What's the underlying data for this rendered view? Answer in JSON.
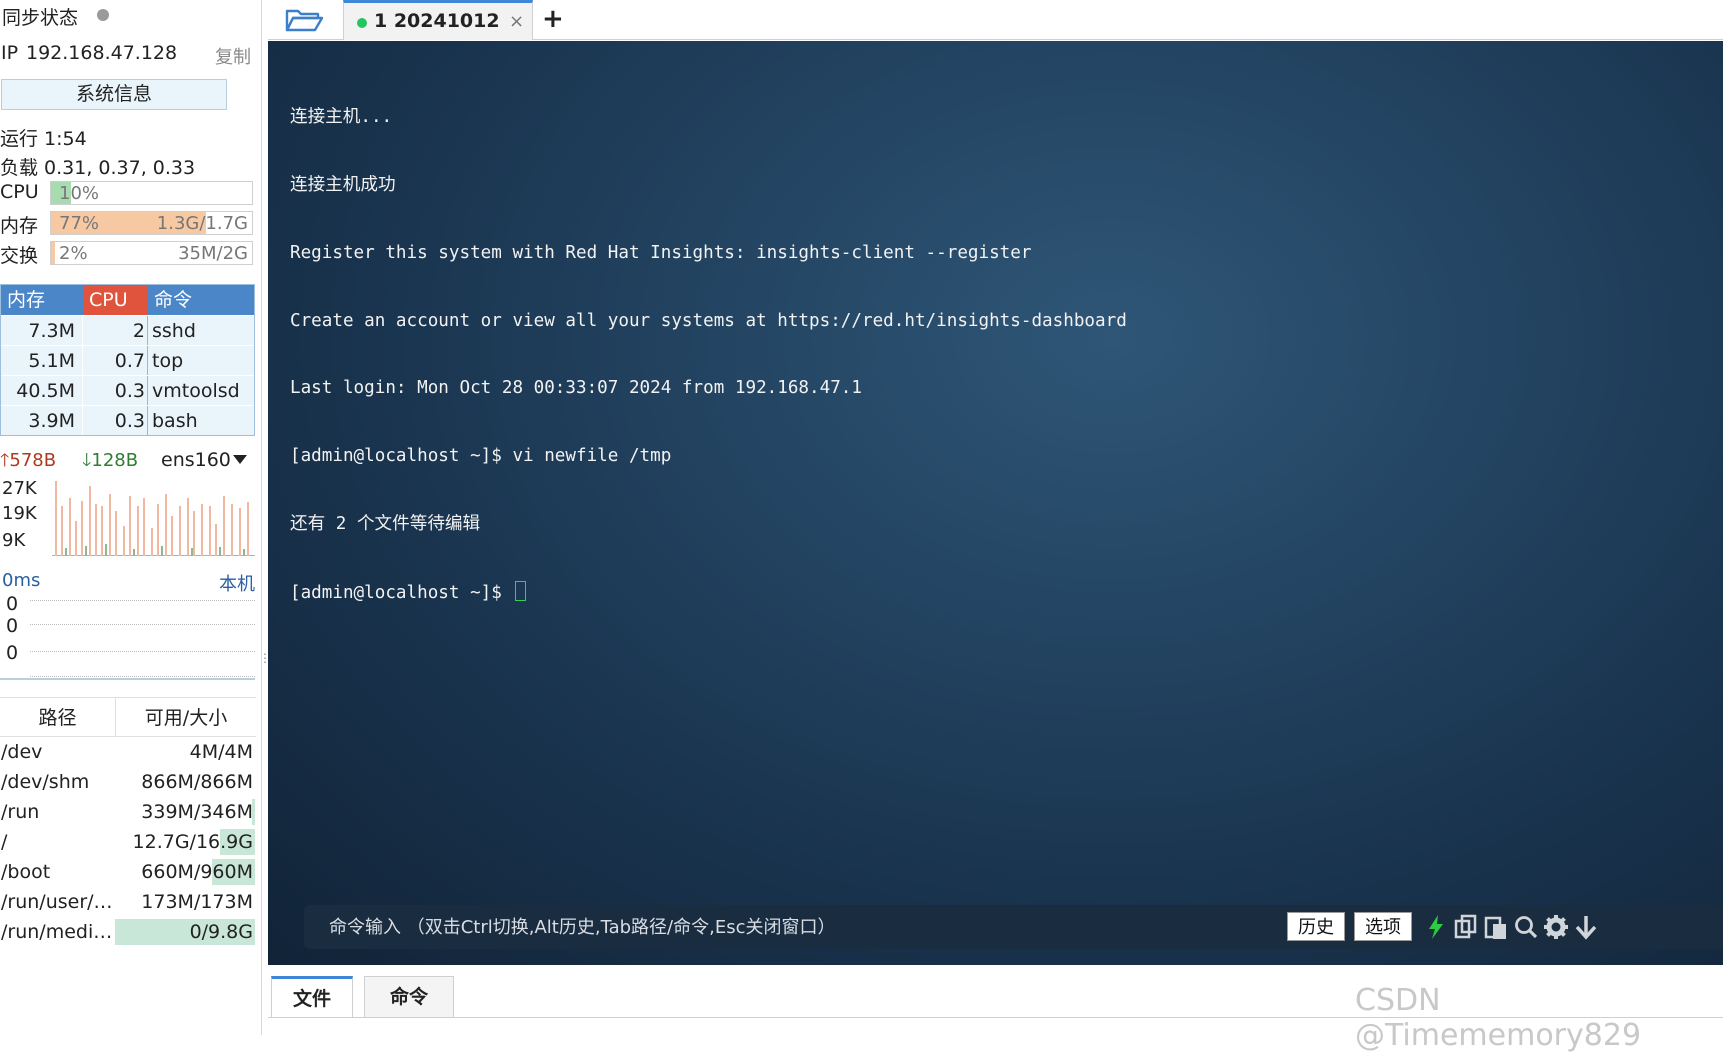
{
  "sidebar": {
    "sync_title": "同步状态",
    "ip_label": "IP",
    "ip": "192.168.47.128",
    "copy": "复制",
    "sysinfo_button": "系统信息",
    "uptime": "运行 1:54",
    "load": "负载 0.31, 0.37, 0.33",
    "cpu": {
      "label": "CPU",
      "text": "10%",
      "fraction": 0.1
    },
    "mem": {
      "label": "内存",
      "text": "77%",
      "detail": "1.3G/1.7G",
      "fraction": 0.77
    },
    "swap": {
      "label": "交换",
      "text": "2%",
      "detail": "35M/2G",
      "fraction": 0.02
    },
    "proc_headers": [
      "内存",
      "CPU",
      "命令"
    ],
    "processes": [
      {
        "mem": "7.3M",
        "cpu": "2",
        "cmd": "sshd"
      },
      {
        "mem": "5.1M",
        "cpu": "0.7",
        "cmd": "top"
      },
      {
        "mem": "40.5M",
        "cpu": "0.3",
        "cmd": "vmtoolsd"
      },
      {
        "mem": "3.9M",
        "cpu": "0.3",
        "cmd": "bash"
      }
    ],
    "net": {
      "up": "578B",
      "down": "128B",
      "interface": "ens160",
      "y_labels": [
        "27K",
        "19K",
        "9K"
      ]
    },
    "ping": {
      "latency": "0ms",
      "host": "本机",
      "y_labels": [
        "0",
        "0",
        "0"
      ]
    },
    "disk_headers": [
      "路径",
      "可用/大小"
    ],
    "disks": [
      {
        "path": "/dev",
        "size": "4M/4M",
        "used": 0.0
      },
      {
        "path": "/dev/shm",
        "size": "866M/866M",
        "used": 0.0
      },
      {
        "path": "/run",
        "size": "339M/346M",
        "used": 0.02
      },
      {
        "path": "/",
        "size": "12.7G/16.9G",
        "used": 0.25
      },
      {
        "path": "/boot",
        "size": "660M/960M",
        "used": 0.31
      },
      {
        "path": "/run/user/1...",
        "size": "173M/173M",
        "used": 0.0
      },
      {
        "path": "/run/media/...",
        "size": "0/9.8G",
        "used": 1.0
      }
    ]
  },
  "tabs": {
    "active_title": "1 20241012",
    "close": "×",
    "add": "+"
  },
  "terminal": {
    "lines": [
      "连接主机...",
      "连接主机成功",
      "Register this system with Red Hat Insights: insights-client --register",
      "Create an account or view all your systems at https://red.ht/insights-dashboard",
      "Last login: Mon Oct 28 00:33:07 2024 from 192.168.47.1",
      "[admin@localhost ~]$ vi newfile /tmp",
      "还有 2 个文件等待编辑"
    ],
    "prompt": "[admin@localhost ~]$ "
  },
  "cmdbar": {
    "placeholder": "命令输入 （双击Ctrl切换,Alt历史,Tab路径/命令,Esc关闭窗口）",
    "history_button": "历史",
    "options_button": "选项"
  },
  "bottom": {
    "tab_files": "文件",
    "tab_commands": "命令",
    "watermark": "CSDN @Timememory829"
  },
  "colors": {
    "accent": "#3d86d8",
    "cpu_fill": "#a8dcb0",
    "mem_fill": "#f7c9a3",
    "swap_fill": "#f7c9a3",
    "terminal_bg": "#1e3a55",
    "status_dot": "#22c55e"
  }
}
